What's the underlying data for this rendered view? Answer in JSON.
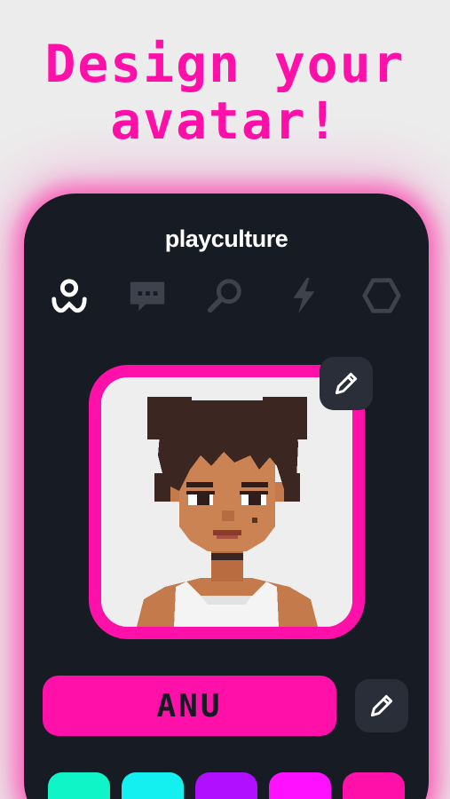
{
  "headline": "Design your\navatar!",
  "app": {
    "brand": "playculture"
  },
  "nav": {
    "items": [
      {
        "icon": "avatar-icon",
        "active": true
      },
      {
        "icon": "chat-icon",
        "active": false
      },
      {
        "icon": "search-icon",
        "active": false
      },
      {
        "icon": "lightning-icon",
        "active": false
      },
      {
        "icon": "hexagon-icon",
        "active": false
      }
    ]
  },
  "profile": {
    "name": "ANU"
  },
  "colors": {
    "accent": "#ff10a8",
    "background": "#171b24",
    "swatches": [
      "#10f5c8",
      "#14f0f0",
      "#b010ff",
      "#ff10ff",
      "#ff10a8"
    ]
  }
}
